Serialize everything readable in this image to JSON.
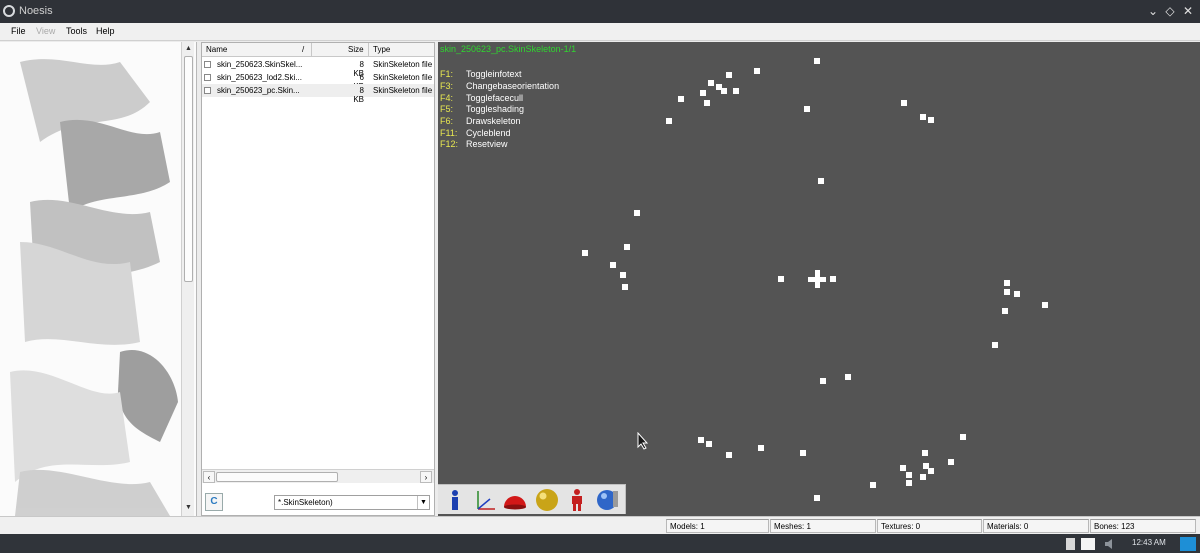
{
  "window": {
    "title": "Noesis"
  },
  "menu": [
    "File",
    "View",
    "Tools",
    "Help"
  ],
  "file_list": {
    "columns": {
      "name": "Name",
      "sort_mark": "/",
      "size": "Size",
      "type": "Type"
    },
    "rows": [
      {
        "name": "skin_250623.SkinSkel...",
        "size": "8 KB",
        "type": "SkinSkeleton file",
        "selected": false
      },
      {
        "name": "skin_250623_lod2.Ski...",
        "size": "6 KB",
        "type": "SkinSkeleton file",
        "selected": false
      },
      {
        "name": "skin_250623_pc.Skin...",
        "size": "8 KB",
        "type": "SkinSkeleton file",
        "selected": true
      }
    ],
    "refresh_label": "C",
    "filter_value": "*.SkinSkeleton)"
  },
  "viewport": {
    "title": "skin_250623_pc.SkinSkeleton-1/1",
    "key_help": [
      {
        "key": "F1:",
        "desc": "Toggleinfotext"
      },
      {
        "key": "F3:",
        "desc": "Changebaseorientation"
      },
      {
        "key": "F4:",
        "desc": "Togglefacecull"
      },
      {
        "key": "F5:",
        "desc": "Toggleshading"
      },
      {
        "key": "F6:",
        "desc": "Drawskeleton"
      },
      {
        "key": "F11:",
        "desc": "Cycleblend"
      },
      {
        "key": "F12:",
        "desc": "Resetview"
      }
    ],
    "background_color": "#545454",
    "info_color": "#2fd62f",
    "key_color": "#e8e850"
  },
  "toolbar_icons": [
    "info-icon",
    "axes-icon",
    "hemisphere-icon",
    "sphere-icon",
    "figure-icon",
    "globe-icon"
  ],
  "status": {
    "models": "Models: 1",
    "meshes": "Meshes: 1",
    "textures": "Textures: 0",
    "materials": "Materials: 0",
    "bones": "Bones: 123"
  },
  "taskbar": {
    "clock": "12:43 AM"
  }
}
